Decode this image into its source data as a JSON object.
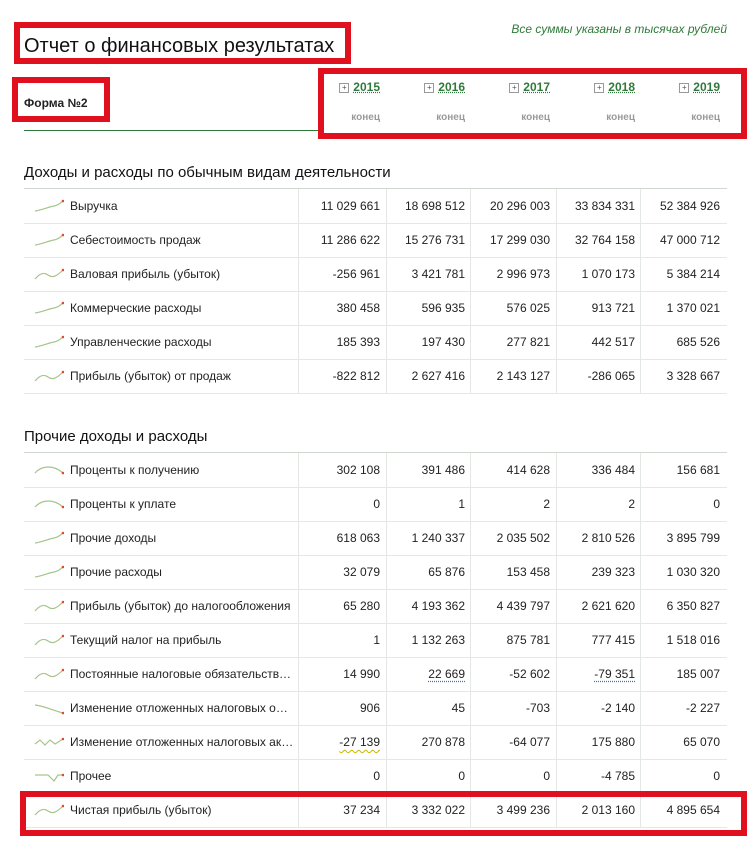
{
  "title": "Отчет о финансовых результатах",
  "note": "Все суммы указаны в тысячах рублей",
  "form_label": "Форма №2",
  "columns": [
    {
      "year": "2015",
      "sub": "конец"
    },
    {
      "year": "2016",
      "sub": "конец"
    },
    {
      "year": "2017",
      "sub": "конец"
    },
    {
      "year": "2018",
      "sub": "конец"
    },
    {
      "year": "2019",
      "sub": "конец"
    }
  ],
  "sections": [
    {
      "title": "Доходы и расходы по обычным видам деятельности",
      "rows": [
        {
          "label": "Выручка",
          "values": [
            "11 029 661",
            "18 698 512",
            "20 296 003",
            "33 834 331",
            "52 384 926"
          ],
          "trend": "up"
        },
        {
          "label": "Себестоимость продаж",
          "values": [
            "11 286 622",
            "15 276 731",
            "17 299 030",
            "32 764 158",
            "47 000 712"
          ],
          "trend": "up"
        },
        {
          "label": "Валовая прибыль (убыток)",
          "values": [
            "-256 961",
            "3 421 781",
            "2 996 973",
            "1 070 173",
            "5 384 214"
          ],
          "trend": "wave"
        },
        {
          "label": "Коммерческие расходы",
          "values": [
            "380 458",
            "596 935",
            "576 025",
            "913 721",
            "1 370 021"
          ],
          "trend": "up"
        },
        {
          "label": "Управленческие расходы",
          "values": [
            "185 393",
            "197 430",
            "277 821",
            "442 517",
            "685 526"
          ],
          "trend": "up"
        },
        {
          "label": "Прибыль (убыток) от продаж",
          "values": [
            "-822 812",
            "2 627 416",
            "2 143 127",
            "-286 065",
            "3 328 667"
          ],
          "trend": "wave"
        }
      ]
    },
    {
      "title": "Прочие доходы и расходы",
      "rows": [
        {
          "label": "Проценты к получению",
          "values": [
            "302 108",
            "391 486",
            "414 628",
            "336 484",
            "156 681"
          ],
          "trend": "arch"
        },
        {
          "label": "Проценты к уплате",
          "values": [
            "0",
            "1",
            "2",
            "2",
            "0"
          ],
          "trend": "arch"
        },
        {
          "label": "Прочие доходы",
          "values": [
            "618 063",
            "1 240 337",
            "2 035 502",
            "2 810 526",
            "3 895 799"
          ],
          "trend": "up"
        },
        {
          "label": "Прочие расходы",
          "values": [
            "32 079",
            "65 876",
            "153 458",
            "239 323",
            "1 030 320"
          ],
          "trend": "up"
        },
        {
          "label": "Прибыль (убыток) до налогообложения",
          "values": [
            "65 280",
            "4 193 362",
            "4 439 797",
            "2 621 620",
            "6 350 827"
          ],
          "trend": "wave"
        },
        {
          "label": "Текущий налог на прибыль",
          "values": [
            "1",
            "1 132 263",
            "875 781",
            "777 415",
            "1 518 016"
          ],
          "trend": "wave"
        },
        {
          "label": "Постоянные налоговые обязательства (активы)",
          "values": [
            "14 990",
            "22 669",
            "-52 602",
            "-79 351",
            "185 007"
          ],
          "trend": "wave"
        },
        {
          "label": "Изменение отложенных налоговых обязательств",
          "values": [
            "906",
            "45",
            "-703",
            "-2 140",
            "-2 227"
          ],
          "trend": "down"
        },
        {
          "label": "Изменение отложенных налоговых активов",
          "values": [
            "-27 139",
            "270 878",
            "-64 077",
            "175 880",
            "65 070"
          ],
          "trend": "zigzag"
        },
        {
          "label": "Прочее",
          "values": [
            "0",
            "0",
            "0",
            "-4 785",
            "0"
          ],
          "trend": "dip"
        },
        {
          "label": "Чистая прибыль (убыток)",
          "values": [
            "37 234",
            "3 332 022",
            "3 499 236",
            "2 013 160",
            "4 895 654"
          ],
          "trend": "wave"
        }
      ]
    }
  ],
  "colors": {
    "accent": "#2f7a3a",
    "highlight": "#e0101f",
    "spark": "#a6c48a",
    "spark_end": "#e04b2f"
  }
}
